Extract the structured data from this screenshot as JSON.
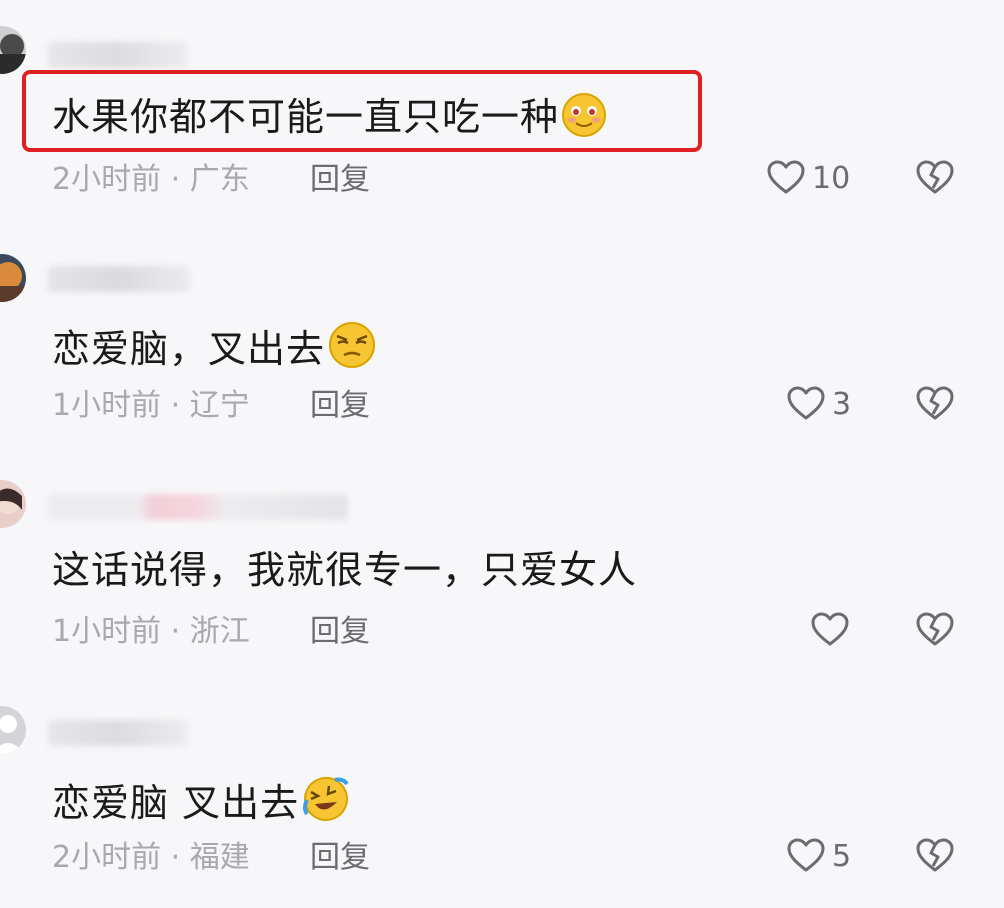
{
  "comments": [
    {
      "text": "水果你都不可能一直只吃一种",
      "time": "2小时前",
      "location": "广东",
      "reply": "回复",
      "likes": "10",
      "emoji": "smiling-blush"
    },
    {
      "text": "恋爱脑，叉出去",
      "time": "1小时前",
      "location": "辽宁",
      "reply": "回复",
      "likes": "3",
      "emoji": "smirk"
    },
    {
      "text": "这话说得，我就很专一，只爱女人",
      "time": "1小时前",
      "location": "浙江",
      "reply": "回复",
      "likes": ""
    },
    {
      "text": "恋爱脑 叉出去",
      "time": "2小时前",
      "location": "福建",
      "reply": "回复",
      "likes": "5",
      "emoji": "laughing-tears"
    }
  ],
  "separator": " · ",
  "colors": {
    "highlight": "#e02020",
    "meta": "#a8a8ad",
    "action": "#6b6b70"
  }
}
